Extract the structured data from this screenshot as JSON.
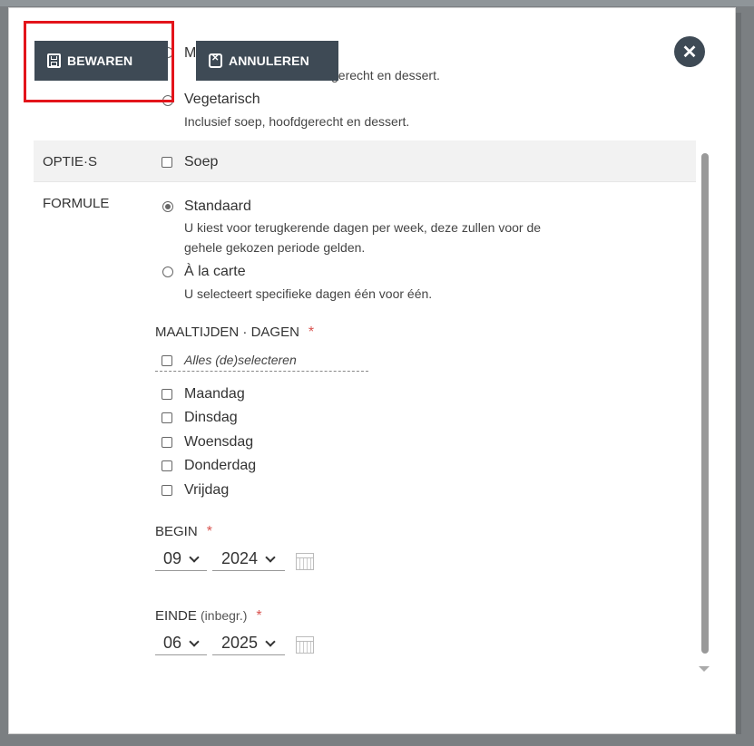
{
  "toolbar": {
    "save_label": "BEWAREN",
    "cancel_label": "ANNULEREN"
  },
  "close_button": {
    "symbol": "✕"
  },
  "meals": {
    "partial_option_label_fragment": "M",
    "partial_desc_fragment": "gerecht en dessert.",
    "vegetarian_label": "Vegetarisch",
    "vegetarian_desc": "Inclusief soep, hoofdgerecht en dessert."
  },
  "options": {
    "label": "OPTIE·S",
    "soup_label": "Soep"
  },
  "formula": {
    "label": "FORMULE",
    "standard_label": "Standaard",
    "standard_desc_line1": "U kiest voor terugkerende dagen per week, deze zullen voor de",
    "standard_desc_line2": "gehele gekozen periode gelden.",
    "alacarte_label": "À la carte",
    "alacarte_desc": "U selecteert specifieke dagen één voor één.",
    "selected": "Standaard"
  },
  "days": {
    "label": "MAALTIJDEN · DAGEN",
    "required_mark": "*",
    "select_all_label": "Alles (de)selecteren",
    "items": [
      "Maandag",
      "Dinsdag",
      "Woensdag",
      "Donderdag",
      "Vrijdag"
    ]
  },
  "begin": {
    "label": "BEGIN",
    "required_mark": "*",
    "month": "09",
    "year": "2024"
  },
  "end": {
    "label": "EINDE",
    "label_note": "(inbegr.)",
    "required_mark": "*",
    "month": "06",
    "year": "2025"
  },
  "colors": {
    "button_bg": "#3e4a55",
    "highlight": "#e3141b",
    "required": "#d9534f"
  }
}
